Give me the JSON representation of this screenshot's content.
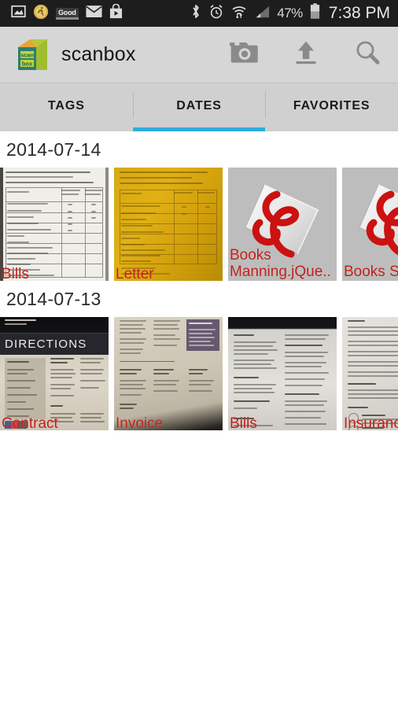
{
  "status_bar": {
    "icons_left": [
      "photo-icon",
      "runner-badge-icon",
      "good-badge-icon",
      "email-icon",
      "play-store-icon"
    ],
    "good_label": "Good",
    "icons_right": [
      "bluetooth-icon",
      "alarm-icon",
      "wifi-icon",
      "signal-icon"
    ],
    "battery_percent": "47%",
    "time": "7:38 PM",
    "background": "#1d1d1d"
  },
  "app_bar": {
    "logo": "scanbox-cube-logo",
    "title": "scanbox",
    "actions": [
      {
        "name": "camera-button",
        "icon": "camera-icon"
      },
      {
        "name": "upload-button",
        "icon": "upload-icon"
      },
      {
        "name": "search-button",
        "icon": "search-icon"
      }
    ],
    "background": "#d6d6d6"
  },
  "tabs": {
    "selected_index": 1,
    "indicator_color": "#2eadde",
    "items": [
      {
        "label": "TAGS"
      },
      {
        "label": "DATES"
      },
      {
        "label": "FAVORITES"
      }
    ]
  },
  "sections": [
    {
      "date": "2014-07-14",
      "items": [
        {
          "label": "Bills",
          "kind": "scan",
          "style": "doc-bills-a",
          "ink": "#2f2c26"
        },
        {
          "label": "Letter",
          "kind": "scan",
          "style": "doc-letter",
          "ink": "#6b4f05"
        },
        {
          "label": "Books Manning.jQue..",
          "kind": "pdf",
          "style": "doc-pdf",
          "ink": "#777777"
        },
        {
          "label": "Books Single.Pa",
          "kind": "pdf",
          "style": "doc-pdf",
          "ink": "#777777"
        }
      ]
    },
    {
      "date": "2014-07-13",
      "items": [
        {
          "label": "Contract",
          "kind": "scan",
          "style": "doc-contract",
          "ink": "#3b382f"
        },
        {
          "label": "Invoice",
          "kind": "scan",
          "style": "doc-invoice",
          "ink": "#4a463b"
        },
        {
          "label": "Bills",
          "kind": "scan",
          "style": "doc-bills-b",
          "ink": "#3a3a38"
        },
        {
          "label": "Insurance",
          "kind": "scan",
          "style": "doc-insurance",
          "ink": "#3d3b36"
        }
      ]
    }
  ],
  "colors": {
    "label_red": "#c0201a",
    "accent_blue": "#2eadde",
    "chrome_gray": "#d6d6d6"
  }
}
